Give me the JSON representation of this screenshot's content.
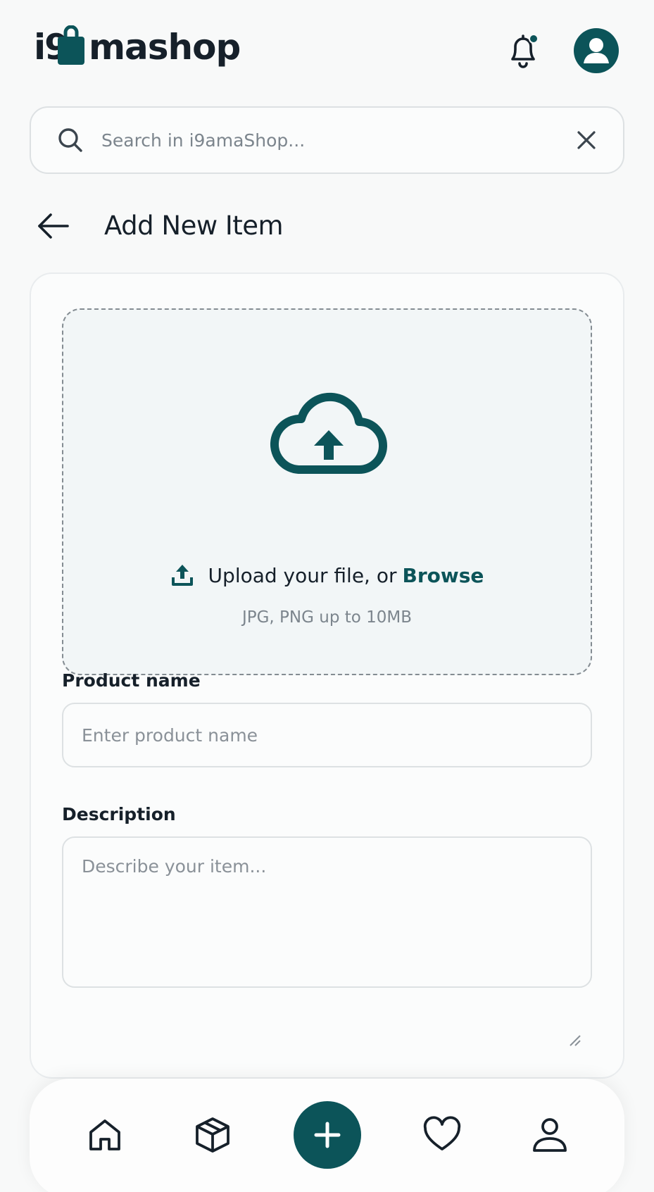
{
  "header": {
    "logo_text": "mashop",
    "logo_prefix": "i9"
  },
  "search": {
    "placeholder": "Search in i9amaShop...",
    "value": ""
  },
  "page": {
    "title": "Add New Item"
  },
  "upload": {
    "prompt": "Upload your file, or",
    "browse_label": "Browse",
    "hint": "JPG, PNG up to 10MB"
  },
  "form": {
    "product_name_label": "Product name",
    "product_name_placeholder": "Enter product name",
    "product_name_value": "",
    "description_label": "Description",
    "description_placeholder": "Describe your item...",
    "description_value": ""
  },
  "bottom_nav": {
    "items": [
      {
        "icon": "home-icon"
      },
      {
        "icon": "box-icon"
      },
      {
        "icon": "plus-icon"
      },
      {
        "icon": "heart-icon"
      },
      {
        "icon": "user-icon"
      }
    ]
  },
  "colors": {
    "brand": "#0c5459",
    "text": "#16202a",
    "muted": "#7c858d",
    "background": "#f8f9f9",
    "dropzone": "#f2f6f7"
  },
  "notifications": {
    "has_unread": true
  }
}
